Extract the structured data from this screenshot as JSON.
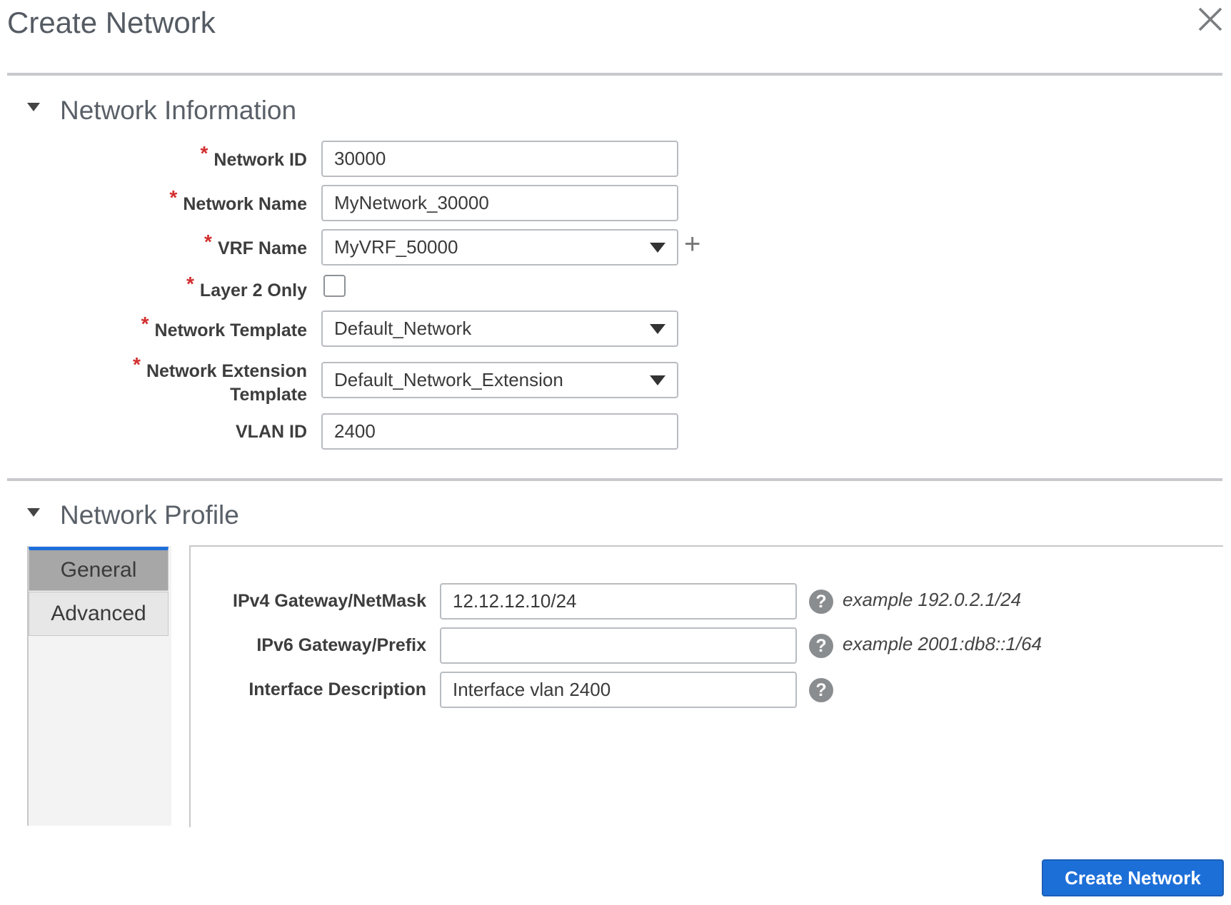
{
  "dialog": {
    "title": "Create Network"
  },
  "network_info": {
    "section_title": "Network Information",
    "network_id": {
      "label": "Network ID",
      "value": "30000",
      "required": true
    },
    "network_name": {
      "label": "Network Name",
      "value": "MyNetwork_30000",
      "required": true
    },
    "vrf_name": {
      "label": "VRF Name",
      "value": "MyVRF_50000",
      "required": true
    },
    "layer2_only": {
      "label": "Layer 2 Only",
      "checked": false,
      "required": true
    },
    "network_template": {
      "label": "Network Template",
      "value": "Default_Network",
      "required": true
    },
    "network_extension_template": {
      "label_line1": "Network Extension",
      "label_line2": "Template",
      "value": "Default_Network_Extension",
      "required": true
    },
    "vlan_id": {
      "label": "VLAN ID",
      "value": "2400"
    }
  },
  "network_profile": {
    "section_title": "Network Profile",
    "tabs": [
      {
        "label": "General",
        "active": true
      },
      {
        "label": "Advanced",
        "active": false
      }
    ],
    "general": {
      "ipv4_gateway": {
        "label": "IPv4 Gateway/NetMask",
        "value": "12.12.12.10/24",
        "hint": "example 192.0.2.1/24"
      },
      "ipv6_gateway": {
        "label": "IPv6 Gateway/Prefix",
        "value": "",
        "hint": "example 2001:db8::1/64"
      },
      "interface_description": {
        "label": "Interface Description",
        "value": "Interface vlan 2400"
      }
    }
  },
  "footer": {
    "create_button": "Create Network"
  },
  "icons": {
    "close": "close-icon",
    "help": "help-icon",
    "add": "plus-icon",
    "collapse": "caret-down-icon"
  },
  "colors": {
    "primary": "#1d6fd8",
    "required": "#d32f2f",
    "active_tab_accent": "#1e6fd9"
  }
}
